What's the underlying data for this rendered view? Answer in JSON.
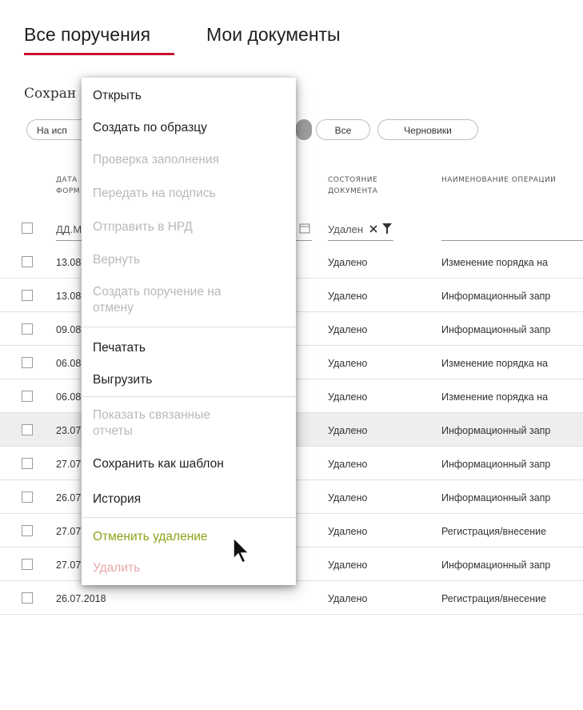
{
  "tabs": {
    "all": "Все поручения",
    "mine": "Мои документы"
  },
  "saved_label": "Сохран",
  "chips": {
    "exec": "На исп",
    "all": "Все",
    "drafts": "Черновики"
  },
  "headers": {
    "date": "ДАТА ФОРМ",
    "state": "СОСТОЯНИЕ ДОКУМЕНТА",
    "operation": "НАИМЕНОВАНИЕ ОПЕРАЦИИ"
  },
  "filters": {
    "date_placeholder": "ДД.М",
    "state_value": "Удален"
  },
  "rows": [
    {
      "date": "13.08",
      "state": "Удалено",
      "op": "Изменение порядка на"
    },
    {
      "date": "13.08",
      "state": "Удалено",
      "op": "Информационный запр"
    },
    {
      "date": "09.08",
      "state": "Удалено",
      "op": "Информационный запр"
    },
    {
      "date": "06.08",
      "state": "Удалено",
      "op": "Изменение порядка на"
    },
    {
      "date": "06.08",
      "state": "Удалено",
      "op": "Изменение порядка на"
    },
    {
      "date": "23.07",
      "state": "Удалено",
      "op": "Информационный запр"
    },
    {
      "date": "27.07",
      "state": "Удалено",
      "op": "Информационный запр"
    },
    {
      "date": "26.07",
      "state": "Удалено",
      "op": "Информационный запр"
    },
    {
      "date": "27.07.2018",
      "state": "Удалено",
      "op": "Регистрация/внесение"
    },
    {
      "date": "27.07.2018",
      "state": "Удалено",
      "op": "Информационный запр"
    },
    {
      "date": "26.07.2018",
      "state": "Удалено",
      "op": "Регистрация/внесение"
    }
  ],
  "menu": {
    "open": "Открыть",
    "create_from_template": "Создать по образцу",
    "check_fill": "Проверка заполнения",
    "send_for_sign": "Передать на подпись",
    "send_to_nrd": "Отправить в НРД",
    "return": "Вернуть",
    "create_cancel_1": "Создать поручение на",
    "create_cancel_2": "отмену",
    "print": "Печатать",
    "export": "Выгрузить",
    "show_reports_1": "Показать связанные",
    "show_reports_2": "отчеты",
    "save_as_template": "Сохранить как шаблон",
    "history": "История",
    "undo_delete": "Отменить удаление",
    "delete": "Удалить"
  },
  "colors": {
    "accent": "#c8102e",
    "menu_green": "#8aa617",
    "menu_red": "#e9a7ad",
    "disabled": "#b9b9b9"
  },
  "icons": {
    "filter": "filter-funnel-icon",
    "clear": "close-icon",
    "calendar": "calendar-icon",
    "cursor": "mouse-pointer-icon"
  }
}
